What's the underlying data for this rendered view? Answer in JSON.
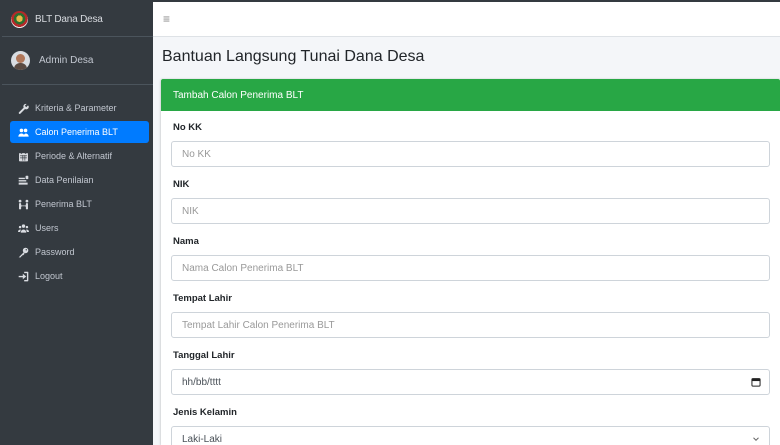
{
  "brand": {
    "title": "BLT Dana Desa"
  },
  "user": {
    "name": "Admin Desa"
  },
  "sidebar": {
    "items": [
      {
        "label": "Kriteria & Parameter",
        "icon": "wrench-icon"
      },
      {
        "label": "Calon Penerima BLT",
        "icon": "users-icon",
        "active": true
      },
      {
        "label": "Periode & Alternatif",
        "icon": "calendar-icon"
      },
      {
        "label": "Data Penilaian",
        "icon": "clipboard-icon"
      },
      {
        "label": "Penerima BLT",
        "icon": "people-arrows-icon"
      },
      {
        "label": "Users",
        "icon": "user-group-icon"
      },
      {
        "label": "Password",
        "icon": "key-icon"
      },
      {
        "label": "Logout",
        "icon": "logout-icon"
      }
    ]
  },
  "topbar": {
    "menu_icon": "≡"
  },
  "page": {
    "title": "Bantuan Langsung Tunai Dana Desa"
  },
  "form": {
    "card_title": "Tambah Calon Penerima BLT",
    "no_kk": {
      "label": "No KK",
      "placeholder": "No KK"
    },
    "nik": {
      "label": "NIK",
      "placeholder": "NIK"
    },
    "nama": {
      "label": "Nama",
      "placeholder": "Nama Calon Penerima BLT"
    },
    "tempat_lahir": {
      "label": "Tempat Lahir",
      "placeholder": "Tempat Lahir Calon Penerima BLT"
    },
    "tanggal_lahir": {
      "label": "Tanggal Lahir",
      "value": "hh/bb/tttt"
    },
    "jenis_kelamin": {
      "label": "Jenis Kelamin",
      "value": "Laki-Laki"
    }
  },
  "colors": {
    "sidebar": "#343a40",
    "active": "#007bff",
    "card_header": "#28a745"
  }
}
